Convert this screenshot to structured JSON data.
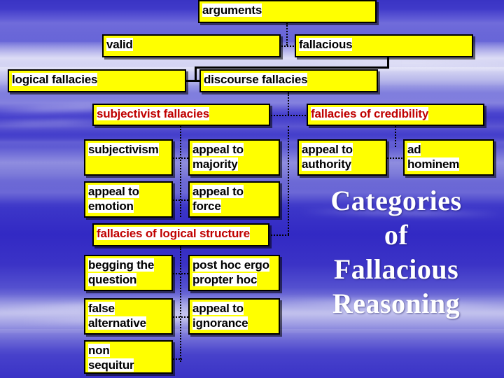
{
  "slide": {
    "title_text": "Categories\nof\nFallacious\nReasoning",
    "background_color": "#3a33c6",
    "node_fill_color": "#ffff00",
    "node_border_color": "#000000",
    "node_text_color": "#000000",
    "category_text_color": "#c00000",
    "title_text_color": "#ffffff"
  },
  "diagram": {
    "nodes": [
      {
        "id": "arguments",
        "label": "arguments",
        "style": "black"
      },
      {
        "id": "valid",
        "label": "valid",
        "style": "black"
      },
      {
        "id": "fallacious",
        "label": "fallacious",
        "style": "black"
      },
      {
        "id": "logical-fallacies",
        "label": "logical fallacies",
        "style": "black"
      },
      {
        "id": "discourse-fallacies",
        "label": "discourse fallacies",
        "style": "black"
      },
      {
        "id": "subjectivist",
        "label": "subjectivist fallacies",
        "style": "red"
      },
      {
        "id": "credibility",
        "label": "fallacies of credibility",
        "style": "red"
      },
      {
        "id": "subjectivism",
        "label": "subjectivism",
        "style": "black"
      },
      {
        "id": "appeal-majority",
        "label": "appeal to\nmajority",
        "style": "black"
      },
      {
        "id": "appeal-authority",
        "label": "appeal to\nauthority",
        "style": "black"
      },
      {
        "id": "ad-hominem",
        "label": "ad\nhominem",
        "style": "black"
      },
      {
        "id": "appeal-emotion",
        "label": "appeal to\nemotion",
        "style": "black"
      },
      {
        "id": "appeal-force",
        "label": "appeal to\nforce",
        "style": "black"
      },
      {
        "id": "logical-structure",
        "label": "fallacies of logical structure",
        "style": "red"
      },
      {
        "id": "begging",
        "label": "begging the\nquestion",
        "style": "black"
      },
      {
        "id": "post-hoc",
        "label": "post hoc ergo\npropter hoc",
        "style": "black"
      },
      {
        "id": "false-alternative",
        "label": "false\nalternative",
        "style": "black"
      },
      {
        "id": "appeal-ignorance",
        "label": "appeal to\nignorance",
        "style": "black"
      },
      {
        "id": "non-sequitur",
        "label": "non\nsequitur",
        "style": "black"
      }
    ]
  }
}
